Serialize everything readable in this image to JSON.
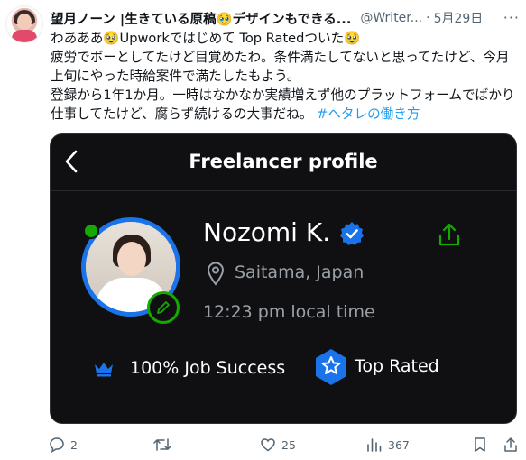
{
  "tweet": {
    "author": "望月ノーン |生きている原稿🥹デザインもできる...",
    "handle": "@Writer...",
    "separator": "·",
    "date": "5月29日",
    "more": "···",
    "text_lines": [
      "わあああ🥹Upworkではじめて Top Ratedついた🥹",
      "疲労でボーとしてたけど目覚めたわ。条件満たしてないと思ってたけど、今月上旬にやった時給案件で満たしたもよう。",
      "登録から1年1か月。一時はなかなか実績増えず他のプラットフォームでばかり仕事してたけど、腐らず続けるの大事だね。"
    ],
    "hashtag": "#ヘタレの働き方"
  },
  "card": {
    "title": "Freelancer profile",
    "name": "Nozomi K.",
    "location": "Saitama, Japan",
    "local_time": "12:23 pm local time",
    "job_success": "100% Job Success",
    "top_rated": "Top Rated",
    "colors": {
      "accent_green": "#14a800",
      "badge_blue": "#1a73e8"
    }
  },
  "actions": {
    "replies": "2",
    "retweets": "",
    "likes": "25",
    "views": "367"
  },
  "icons": [
    "reply-icon",
    "retweet-icon",
    "like-icon",
    "views-icon",
    "bookmark-icon",
    "share-icon",
    "back-icon",
    "edit-icon",
    "verified-icon",
    "location-icon",
    "crown-icon",
    "top-rated-badge-icon",
    "export-icon"
  ]
}
